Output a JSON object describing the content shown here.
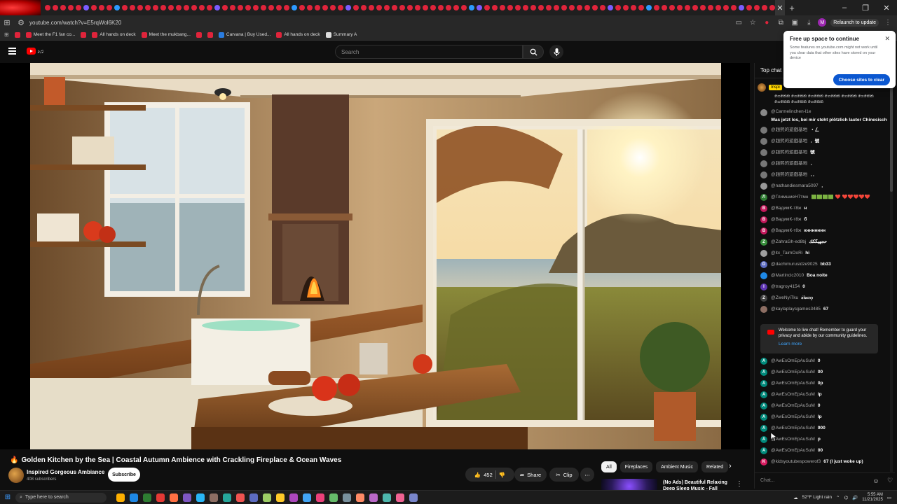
{
  "browser": {
    "url": "youtube.com/watch?v=E5rqWol6K20",
    "relaunch_label": "Relaunch to update",
    "profile_initial": "M",
    "window_controls": [
      "–",
      "❐",
      "✕"
    ],
    "new_tab": "+",
    "close_tab": "✕"
  },
  "bookmarks": [
    {
      "label": "Meet the F1 fan co...",
      "icon": "red"
    },
    {
      "label": "All hands on deck",
      "icon": "red"
    },
    {
      "label": "Meet the mukbang...",
      "icon": "red"
    },
    {
      "label": "Carvana | Buy Used...",
      "icon": "blue"
    },
    {
      "label": "All hands on deck",
      "icon": "red"
    },
    {
      "label": "Summary A",
      "icon": "white"
    }
  ],
  "youtube": {
    "search_placeholder": "Search"
  },
  "video": {
    "title": "Golden Kitchen by the Sea | Coastal Autumn Ambience with Crackling Fireplace & Ocean Waves",
    "channel": "Inspired Gorgeous Ambiance",
    "subscribers": "408 subscribers",
    "subscribe_label": "Subscribe",
    "likes": "452",
    "share_label": "Share",
    "clip_label": "Clip"
  },
  "chips": [
    "All",
    "Fireplaces",
    "Ambient Music",
    "Related"
  ],
  "recommendation": {
    "title": "(No Ads) Beautiful Relaxing Deep Sleep Music - Fall Asleep"
  },
  "chat": {
    "header": "Top chat",
    "pinned_tag": "Inspi",
    "pinned_text": "ගෙකෙක ගෙකෙක ගෙකෙක ගෙකෙක ගෙකෙක ගෙකෙක ගෙකෙක ගෙකෙක ගෙකෙක",
    "messages": [
      {
        "author": "@Carmelinchen-l1e",
        "text": "Was jetzt los, bei mir steht plötzlich lauter Chinesisch",
        "avatar": "#8a8a8a",
        "initial": ""
      },
      {
        "author": "@趙煕的遊戲基地",
        "text": "・ㄥ",
        "avatar": "#777777",
        "initial": ""
      },
      {
        "author": "@趙煕的遊戲基地",
        "text": "．號",
        "avatar": "#777777",
        "initial": ""
      },
      {
        "author": "@趙煕的遊戲基地",
        "text": "號",
        "avatar": "#777777",
        "initial": ""
      },
      {
        "author": "@趙煕的遊戲基地",
        "text": "．",
        "avatar": "#777777",
        "initial": ""
      },
      {
        "author": "@趙煕的遊戲基地",
        "text": "．．",
        "avatar": "#777777",
        "initial": ""
      },
      {
        "author": "@nathandiesmara5097",
        "text": "．",
        "avatar": "#999999",
        "initial": ""
      },
      {
        "author": "@ГлимшиеН7тмн",
        "text": "🟩🟩🟩🟩 ❤️ ❤️❤️❤️❤️❤️",
        "avatar": "#2e7d32",
        "initial": "Л"
      },
      {
        "author": "@ВадимК-т8ж",
        "text": "н",
        "avatar": "#c2185b",
        "initial": "В"
      },
      {
        "author": "@ВадимК-т8ж",
        "text": "б",
        "avatar": "#c2185b",
        "initial": "В"
      },
      {
        "author": "@ВадимК-т8ж",
        "text": "кннннннн",
        "avatar": "#c2185b",
        "initial": "В"
      },
      {
        "author": "@ZahraGh-ed8bj",
        "text": "حجهيگكك",
        "avatar": "#388e3c",
        "initial": "Z"
      },
      {
        "author": "@itx_TaimOoRi",
        "text": "hi",
        "avatar": "#9e9e9e",
        "initial": ""
      },
      {
        "author": "@dachimurusidze9025",
        "text": "bb33",
        "avatar": "#5c6bc0",
        "initial": "D"
      },
      {
        "author": "@Martincic2010",
        "text": "Boa noite",
        "avatar": "#1e88e5",
        "initial": ""
      },
      {
        "author": "@tragroy4154",
        "text": "0",
        "avatar": "#5e35b1",
        "initial": "I"
      },
      {
        "author": "@ZweNyiTku",
        "text": "ဒါတော့",
        "avatar": "#424242",
        "initial": "Z"
      },
      {
        "author": "@kaylaplaysgames3485",
        "text": "67",
        "avatar": "#8d6e63",
        "initial": ""
      }
    ],
    "welcome_text": "Welcome to live chat! Remember to guard your privacy and abide by our community guidelines.",
    "learn_more": "Learn more",
    "messages2": [
      {
        "author": "@AwEsOmEpAuSuM",
        "text": "0",
        "avatar": "#00897b",
        "initial": "A"
      },
      {
        "author": "@AwEsOmEpAuSuM",
        "text": "00",
        "avatar": "#00897b",
        "initial": "A"
      },
      {
        "author": "@AwEsOmEpAuSuM",
        "text": "0p",
        "avatar": "#00897b",
        "initial": "A"
      },
      {
        "author": "@AwEsOmEpAuSuM",
        "text": "lp",
        "avatar": "#00897b",
        "initial": "A"
      },
      {
        "author": "@AwEsOmEpAuSuM",
        "text": "0",
        "avatar": "#00897b",
        "initial": "A"
      },
      {
        "author": "@AwEsOmEpAuSuM",
        "text": "lp",
        "avatar": "#00897b",
        "initial": "A"
      },
      {
        "author": "@AwEsOmEpAuSuM",
        "text": "900",
        "avatar": "#00897b",
        "initial": "A"
      },
      {
        "author": "@AwEsOmEpAuSuM",
        "text": "p",
        "avatar": "#00897b",
        "initial": "A"
      },
      {
        "author": "@AwEsOmEpAuSuM",
        "text": "00",
        "avatar": "#00897b",
        "initial": "A"
      },
      {
        "author": "@kidsyoutubespowerof3",
        "text": "67 (I just woke up)",
        "avatar": "#d81b60",
        "initial": "K"
      }
    ],
    "input_placeholder": "Chat..."
  },
  "popup": {
    "title": "Free up space to continue",
    "body": "Some features on youtube.com might not work until you clear data that other sites have stored on your device",
    "button": "Choose sites to clear",
    "close": "✕"
  },
  "taskbar": {
    "search_placeholder": "Type here to search",
    "weather": "52°F  Light rain",
    "time": "5:55 AM",
    "date": "11/21/2025"
  },
  "colors": {
    "accent_red": "#ff0000",
    "chrome_blue": "#0b57d0",
    "link_blue": "#3ea6ff"
  }
}
